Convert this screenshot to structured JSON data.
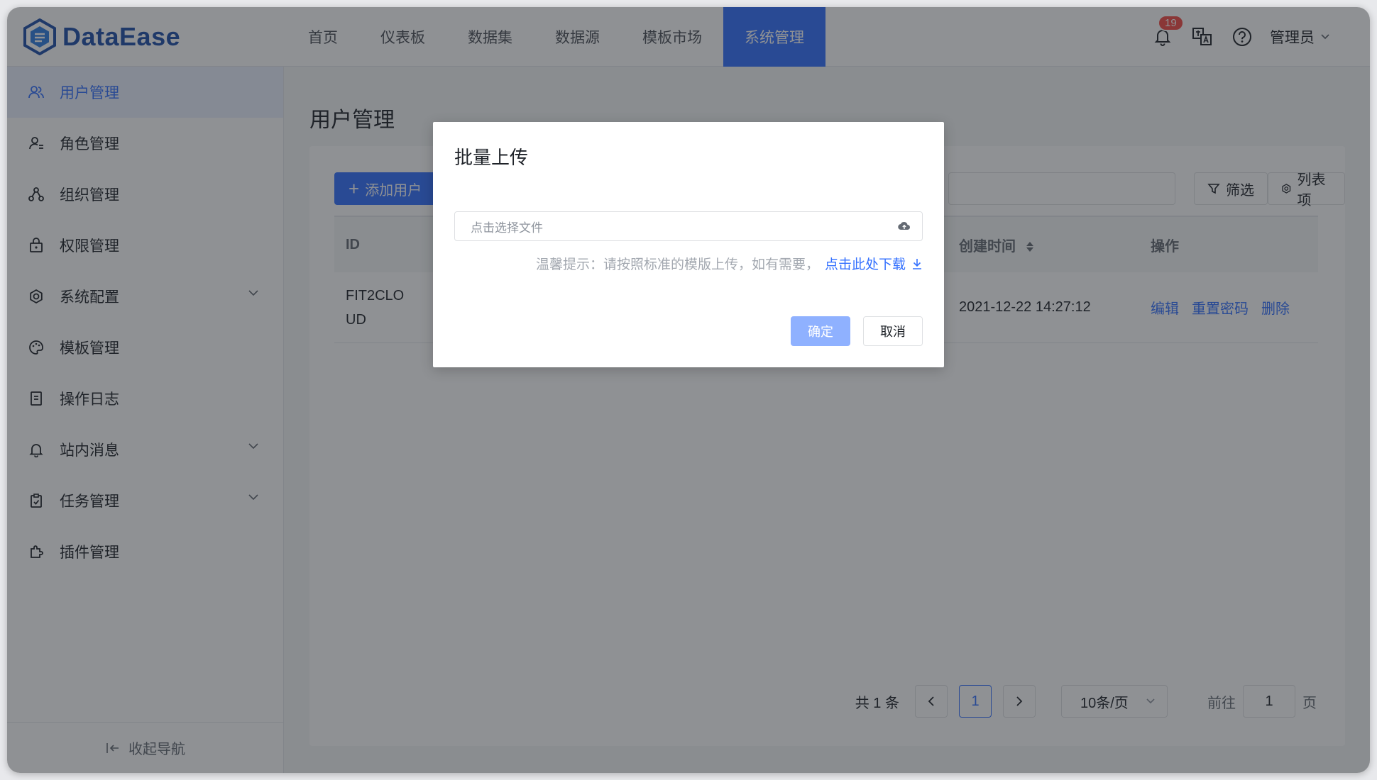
{
  "app": {
    "logo_text": "DataEase"
  },
  "header": {
    "nav": [
      "首页",
      "仪表板",
      "数据集",
      "数据源",
      "模板市场",
      "系统管理"
    ],
    "active_nav": "系统管理",
    "notification_count": "19",
    "user_label": "管理员"
  },
  "sidebar": {
    "items": [
      {
        "label": "用户管理",
        "icon": "user-icon"
      },
      {
        "label": "角色管理",
        "icon": "role-icon"
      },
      {
        "label": "组织管理",
        "icon": "org-icon"
      },
      {
        "label": "权限管理",
        "icon": "lock-icon"
      },
      {
        "label": "系统配置",
        "icon": "gear-icon"
      },
      {
        "label": "模板管理",
        "icon": "palette-icon"
      },
      {
        "label": "操作日志",
        "icon": "document-icon"
      },
      {
        "label": "站内消息",
        "icon": "bell-icon"
      },
      {
        "label": "任务管理",
        "icon": "clipboard-icon"
      },
      {
        "label": "插件管理",
        "icon": "plugin-icon"
      }
    ],
    "footer_label": "收起导航"
  },
  "main": {
    "title": "用户管理",
    "add_user_label": "添加用户",
    "filter_label": "筛选",
    "columns_label": "列表项",
    "table": {
      "headers": {
        "id": "ID",
        "created": "创建时间",
        "ops": "操作"
      },
      "rows": [
        {
          "id_line1": "FIT2CLO",
          "id_line2": "UD",
          "created": "2021-12-22 14:27:12",
          "ops": [
            "编辑",
            "重置密码",
            "删除"
          ]
        }
      ]
    },
    "pager": {
      "total": "共 1 条",
      "current_page": "1",
      "page_size": "10条/页",
      "goto_prefix": "前往",
      "goto_value": "1",
      "goto_suffix": "页"
    }
  },
  "dialog": {
    "title": "批量上传",
    "file_placeholder": "点击选择文件",
    "tip_text": "温馨提示：请按照标准的模版上传，如有需要，",
    "tip_link": "点击此处下载",
    "ok_label": "确定",
    "cancel_label": "取消"
  },
  "colors": {
    "accent": "#3370ff",
    "badge": "#f54a45",
    "brand": "#1f4fa8"
  }
}
